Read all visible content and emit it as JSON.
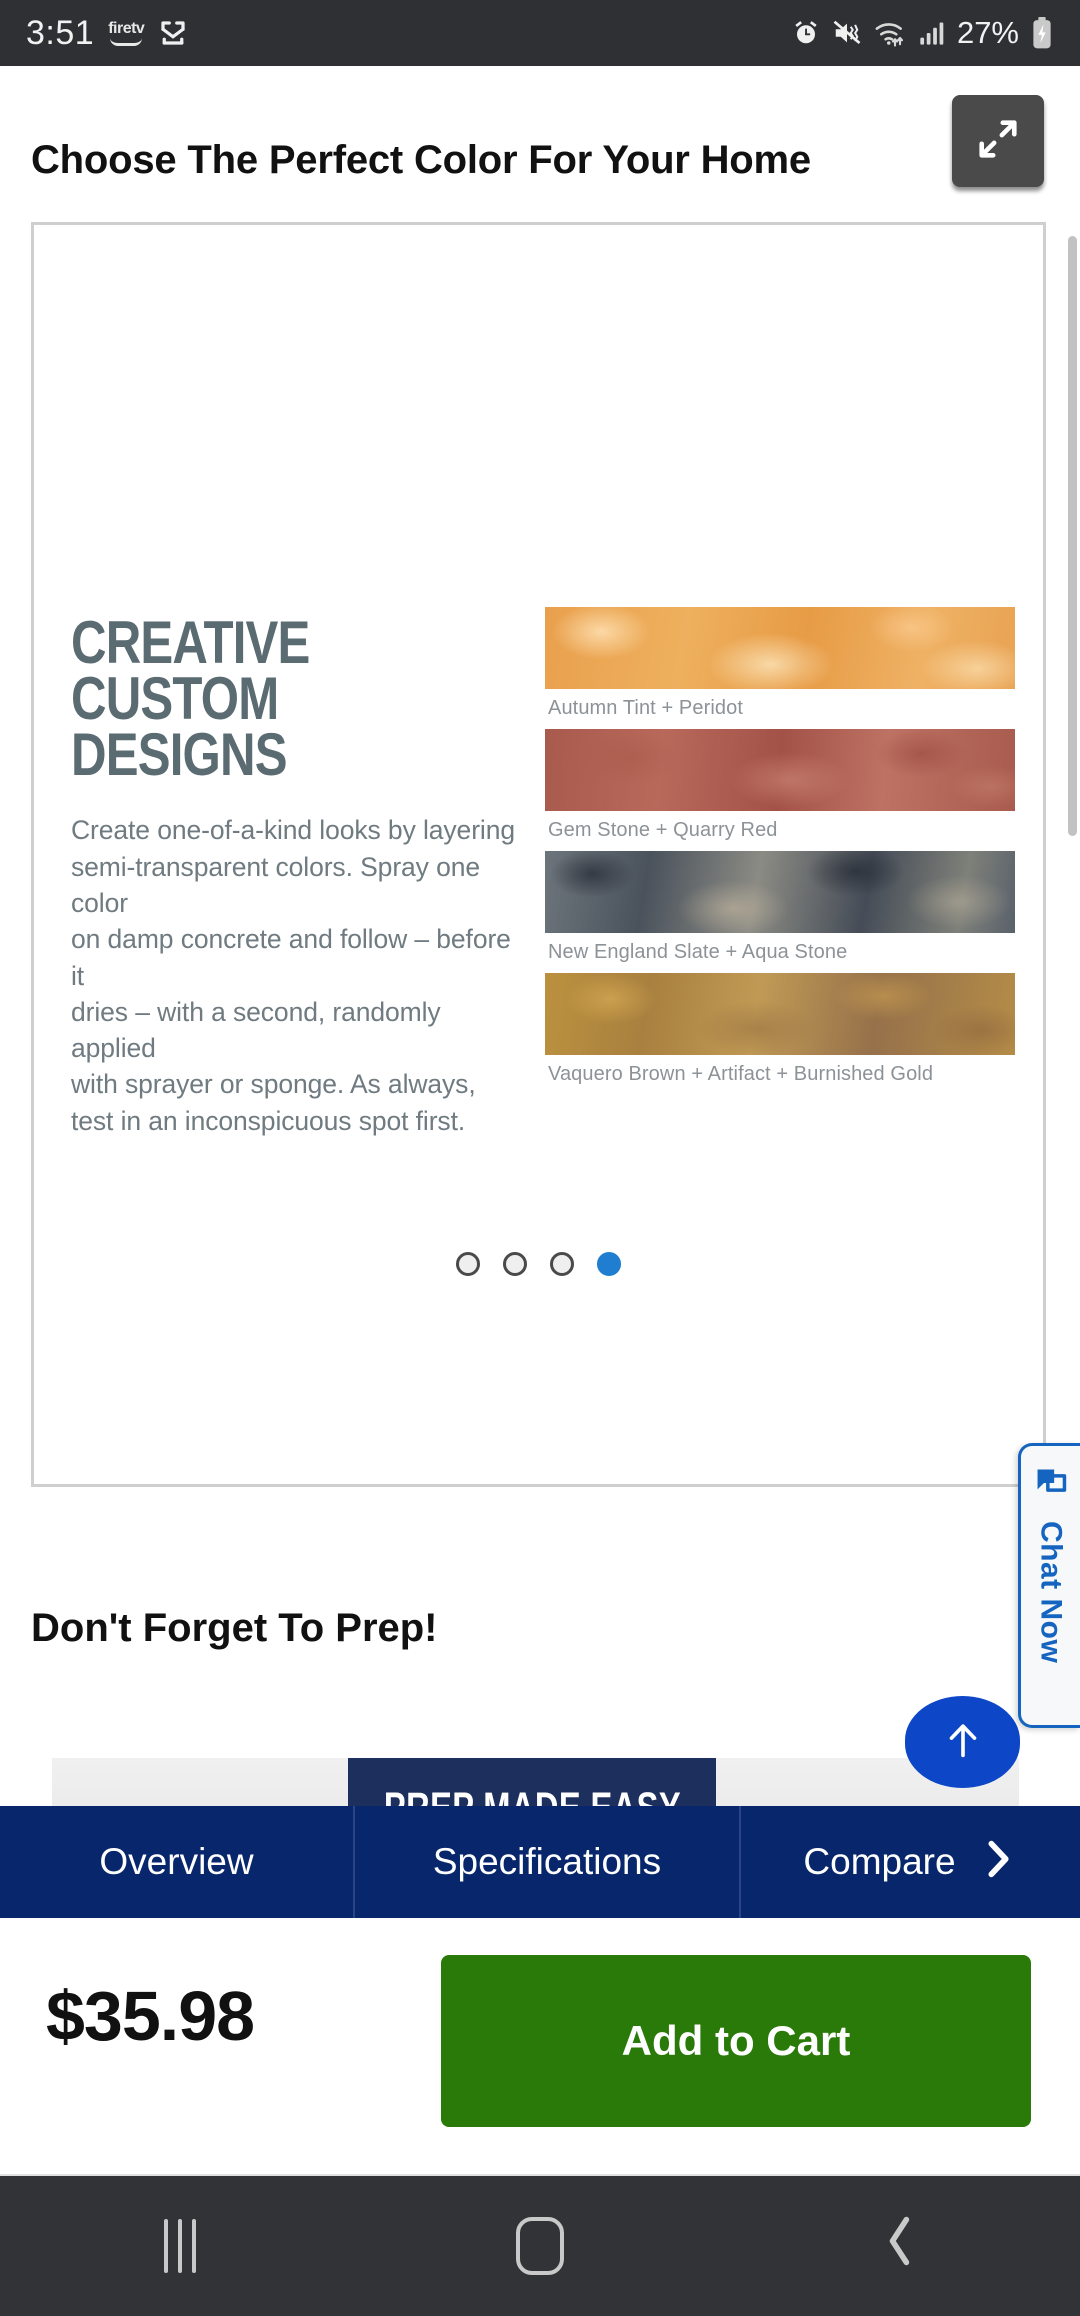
{
  "status_bar": {
    "time": "3:51",
    "firetv_label": "firetv",
    "icons": [
      "firetv-logo",
      "cast-icon",
      "alarm-icon",
      "vibrate-off-icon",
      "wifi-icon",
      "signal-icon",
      "battery-charging-icon"
    ],
    "battery_percent": "27%"
  },
  "header": {
    "title": "Choose The Perfect Color For Your Home",
    "expand_icon": "expand-icon"
  },
  "carousel": {
    "slide": {
      "headline": "CREATIVE\nCUSTOM DESIGNS",
      "body": "Create one-of-a-kind looks by layering\nsemi-transparent colors. Spray one color\non damp concrete and follow – before it\ndries – with a second, randomly applied\nwith sprayer or sponge. As always,\ntest in an inconspicuous spot first.",
      "swatches": [
        {
          "label": "Autumn Tint + Peridot",
          "color": "#e9a04d"
        },
        {
          "label": "Gem Stone + Quarry Red",
          "color": "#a85a4d"
        },
        {
          "label": "New England Slate + Aqua Stone",
          "color": "#6d757c"
        },
        {
          "label": "Vaquero Brown + Artifact + Burnished Gold",
          "color": "#bb913f"
        }
      ]
    },
    "dots": {
      "count": 4,
      "active_index": 3,
      "active_color": "#1f7ed0"
    }
  },
  "chat_widget": {
    "label": "Chat Now",
    "icon": "chat-icon",
    "accent_color": "#1565c0"
  },
  "prep_section": {
    "title": "Don't Forget To Prep!",
    "banner_text": "PREP MADE EASY",
    "banner_color": "#1d2f5c"
  },
  "scroll_top_button": {
    "icon": "arrow-up-icon",
    "color": "#0d47c8"
  },
  "tab_bar": {
    "background": "#07266b",
    "tabs": [
      {
        "label": "Overview"
      },
      {
        "label": "Specifications"
      },
      {
        "label": "Compare"
      }
    ],
    "next_icon": "chevron-right-icon"
  },
  "purchase_bar": {
    "price": "$35.98",
    "add_to_cart_label": "Add to Cart",
    "add_to_cart_color": "#2a7a09"
  },
  "nav_bar": {
    "recents_icon": "recents-icon",
    "home_icon": "home-icon",
    "back_icon": "back-icon"
  }
}
